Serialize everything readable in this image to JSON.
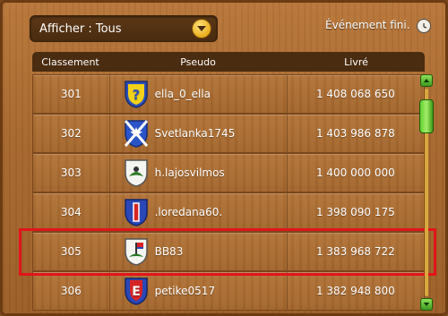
{
  "header": {
    "filter_label": "Afficher : Tous",
    "event_status": "Événement fini.",
    "dropdown_icon": "chevron-down-icon",
    "clock_icon": "clock-icon"
  },
  "table": {
    "columns": [
      "Classement",
      "Pseudo",
      "Livré"
    ],
    "rows": [
      {
        "rank": "301",
        "pseudo": "ella_0_ella",
        "delivered": "1 408 068 650",
        "badge": "yellow-question-shield"
      },
      {
        "rank": "302",
        "pseudo": "Svetlanka1745",
        "delivered": "1 403 986 878",
        "badge": "blue-star-shield"
      },
      {
        "rank": "303",
        "pseudo": "h.lajosvilmos",
        "delivered": "1 400 000 000",
        "badge": "white-bird-shield"
      },
      {
        "rank": "304",
        "pseudo": ".loredana60.",
        "delivered": "1 398 090 175",
        "badge": "blue-red-bar-shield"
      },
      {
        "rank": "305",
        "pseudo": "BB83",
        "delivered": "1 383 968 722",
        "badge": "white-flag-shield"
      },
      {
        "rank": "306",
        "pseudo": "petike0517",
        "delivered": "1 382 948 800",
        "badge": "red-e-shield"
      }
    ]
  },
  "colors": {
    "wood": "#a8692f",
    "header_bg": "#4a2c10",
    "highlight": "#e2141b",
    "scroll_green": "#5fcf2d"
  }
}
